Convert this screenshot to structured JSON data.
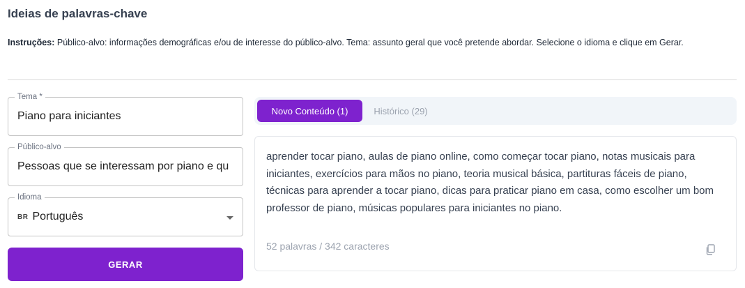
{
  "page": {
    "title": "Ideias de palavras-chave",
    "instructions_label": "Instruções:",
    "instructions_text": "Público-alvo: informações demográficas e/ou de interesse do público-alvo. Tema: assunto geral que você pretende abordar. Selecione o idioma e clique em Gerar."
  },
  "form": {
    "tema": {
      "label": "Tema *",
      "value": "Piano para iniciantes"
    },
    "publico": {
      "label": "Público-alvo",
      "value": "Pessoas que se interessam por piano e qu"
    },
    "idioma": {
      "label": "Idioma",
      "flag": "BR",
      "value": "Português"
    },
    "generate_label": "GERAR"
  },
  "tabs": [
    {
      "label": "Novo Conteúdo (1)",
      "active": true
    },
    {
      "label": "Histórico (29)",
      "active": false
    }
  ],
  "result": {
    "text": "aprender tocar piano, aulas de piano online, como começar tocar piano, notas musicais para iniciantes, exercícios para mãos no piano, teoria musical básica, partituras fáceis de piano, técnicas para aprender a tocar piano, dicas para praticar piano em casa, como escolher um bom professor de piano, músicas populares para iniciantes no piano.",
    "count": "52 palavras / 342 caracteres",
    "copy_icon": "copy-icon"
  },
  "colors": {
    "accent": "#7e22ce",
    "tab_bar_bg": "#f1f5f9",
    "muted_text": "#9ca3af"
  }
}
